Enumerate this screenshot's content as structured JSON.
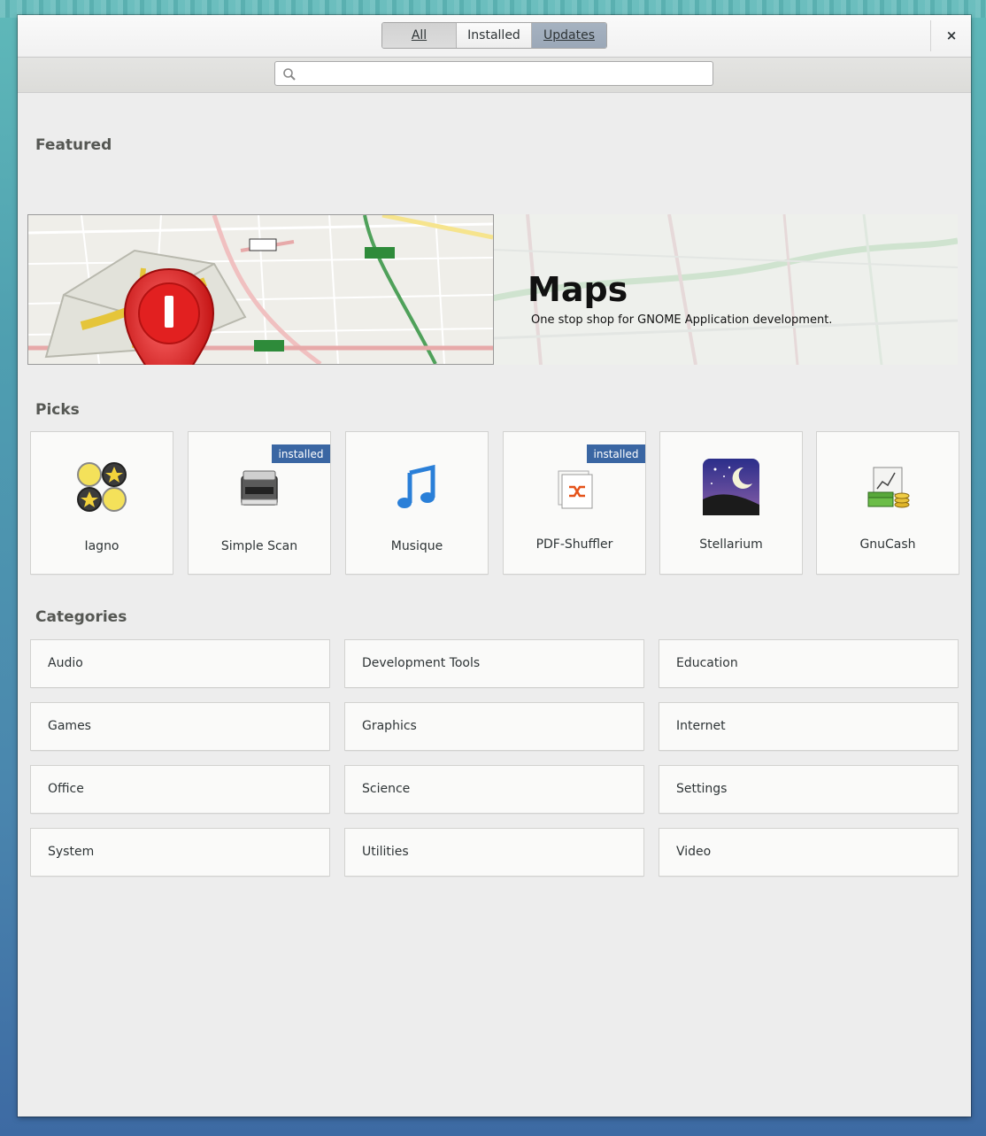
{
  "header": {
    "tabs": [
      {
        "label": "All"
      },
      {
        "label": "Installed"
      },
      {
        "label": "Updates"
      }
    ],
    "close_glyph": "×",
    "close_icon": "close-icon"
  },
  "search": {
    "placeholder": "",
    "value": "",
    "icon": "search-icon"
  },
  "sections": {
    "featured": "Featured",
    "picks": "Picks",
    "categories": "Categories"
  },
  "featured": {
    "title": "Maps",
    "subtitle": "One stop shop for GNOME Application development.",
    "icon": "maps-icon"
  },
  "picks": [
    {
      "name": "Iagno",
      "icon": "iagno-icon",
      "badge": ""
    },
    {
      "name": "Simple Scan",
      "icon": "scanner-icon",
      "badge": "installed"
    },
    {
      "name": "Musique",
      "icon": "music-note-icon",
      "badge": ""
    },
    {
      "name": "PDF-Shuffler",
      "icon": "pdf-shuffler-icon",
      "badge": "installed"
    },
    {
      "name": "Stellarium",
      "icon": "stellarium-icon",
      "badge": ""
    },
    {
      "name": "GnuCash",
      "icon": "gnucash-icon",
      "badge": ""
    }
  ],
  "categories": [
    {
      "label": "Audio"
    },
    {
      "label": "Development Tools"
    },
    {
      "label": "Education"
    },
    {
      "label": "Games"
    },
    {
      "label": "Graphics"
    },
    {
      "label": "Internet"
    },
    {
      "label": "Office"
    },
    {
      "label": "Science"
    },
    {
      "label": "Settings"
    },
    {
      "label": "System"
    },
    {
      "label": "Utilities"
    },
    {
      "label": "Video"
    }
  ],
  "colors": {
    "badge": "#3a66a3",
    "updates_active": "#9ba8b8"
  }
}
